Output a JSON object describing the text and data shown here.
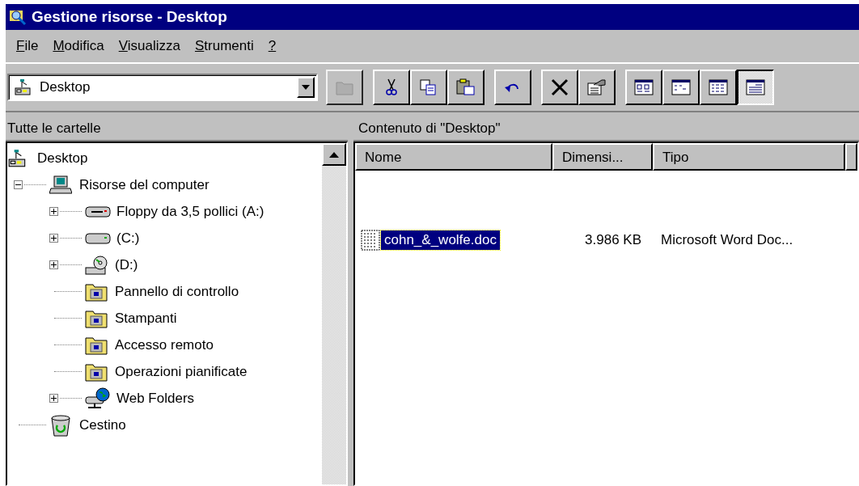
{
  "window": {
    "title": "Gestione risorse - Desktop"
  },
  "menu": [
    {
      "label": "File",
      "mnemonic": true
    },
    {
      "label": "Modifica",
      "mnemonic": true
    },
    {
      "label": "Visualizza",
      "mnemonic": true
    },
    {
      "label": "Strumenti",
      "mnemonic": true
    },
    {
      "label": "?",
      "mnemonic": true
    }
  ],
  "address": {
    "value": "Desktop"
  },
  "toolbar": [
    {
      "kind": "up",
      "disabled": true
    },
    {
      "kind": "cut",
      "disabled": false
    },
    {
      "kind": "copy",
      "disabled": false
    },
    {
      "kind": "paste",
      "disabled": false
    },
    {
      "kind": "undo",
      "disabled": false
    },
    {
      "kind": "delete",
      "disabled": false
    },
    {
      "kind": "properties",
      "disabled": false
    }
  ],
  "views": [
    {
      "kind": "large",
      "selected": false
    },
    {
      "kind": "small",
      "selected": false
    },
    {
      "kind": "list",
      "selected": false
    },
    {
      "kind": "details",
      "selected": true
    }
  ],
  "left_pane": {
    "header": "Tutte le cartelle",
    "tree": [
      {
        "label": "Desktop",
        "kind": "desktop",
        "children": [
          {
            "label": "Risorse del computer",
            "kind": "computer",
            "expanded": true,
            "children": [
              {
                "label": "Floppy da 3,5 pollici (A:)",
                "kind": "floppy",
                "expanded": false
              },
              {
                "label": "(C:)",
                "kind": "drive",
                "expanded": false
              },
              {
                "label": "(D:)",
                "kind": "cd",
                "expanded": false
              },
              {
                "label": "Pannello di controllo",
                "kind": "folder"
              },
              {
                "label": "Stampanti",
                "kind": "folder"
              },
              {
                "label": "Accesso remoto",
                "kind": "folder"
              },
              {
                "label": "Operazioni pianificate",
                "kind": "folder"
              },
              {
                "label": "Web Folders",
                "kind": "web",
                "expanded": false
              }
            ]
          },
          {
            "label": "Cestino",
            "kind": "trash"
          }
        ]
      }
    ]
  },
  "right_pane": {
    "header": "Contenuto di \"Desktop\"",
    "columns": [
      "Nome",
      "Dimensi...",
      "Tipo"
    ],
    "rows": [
      {
        "name": "cohn_&_wolfe.doc",
        "size": "3.986 KB",
        "type": "Microsoft Word Doc...",
        "selected": true
      }
    ]
  }
}
